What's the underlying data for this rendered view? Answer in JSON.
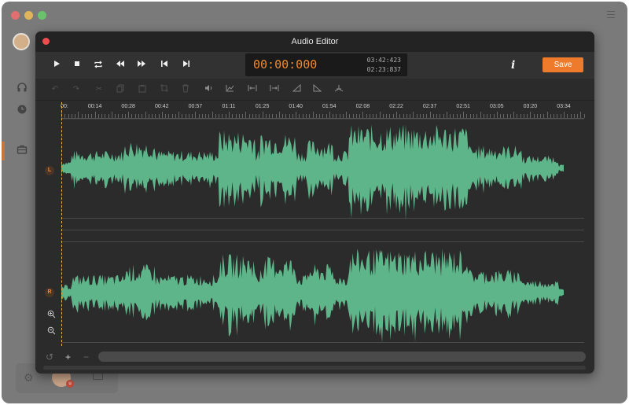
{
  "window": {
    "traffic_colors": [
      "#e26f6f",
      "#e0b45a",
      "#6cc26c"
    ],
    "sidebar_icons": [
      "headphones-icon",
      "clock-icon",
      "toolbox-icon"
    ]
  },
  "editor": {
    "title": "Audio Editor",
    "accent": "#f08a2c",
    "wave_color": "#5fb58a",
    "transport": {
      "buttons": [
        "play-icon",
        "stop-icon",
        "loop-icon",
        "rewind-icon",
        "fast-forward-icon",
        "skip-start-icon",
        "skip-end-icon"
      ],
      "time_main": "00:00:000",
      "time_total": "03:42:423",
      "time_selection": "02:23:837",
      "info_label": "i",
      "save_label": "Save"
    },
    "tools": [
      "undo-icon",
      "redo-icon",
      "cut-icon",
      "copy-icon",
      "paste-icon",
      "crop-icon",
      "delete-icon",
      "volume-icon",
      "amplify-icon",
      "trim-left-icon",
      "trim-right-icon",
      "fade-in-icon",
      "fade-out-icon",
      "pitch-icon"
    ],
    "ruler": {
      "labels": [
        "00:",
        "00:14",
        "00:28",
        "00:42",
        "00:57",
        "01:11",
        "01:25",
        "01:40",
        "01:54",
        "02:08",
        "02:22",
        "02:37",
        "02:51",
        "03:05",
        "03:20",
        "03:34"
      ]
    },
    "channels": {
      "left": "L",
      "right": "R"
    },
    "bottom": {
      "reset": "↺",
      "add": "+",
      "remove": "−"
    }
  }
}
